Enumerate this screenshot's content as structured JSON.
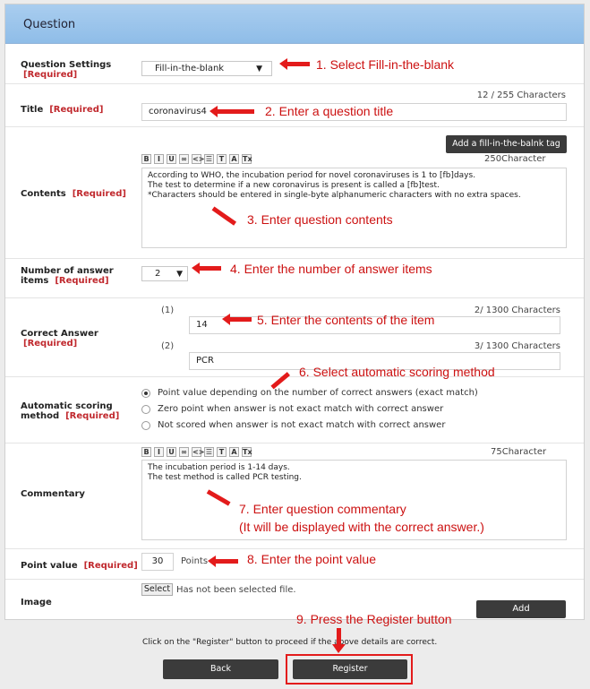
{
  "header": {
    "title": "Question"
  },
  "question_settings": {
    "label": "Question Settings",
    "required": "[Required]",
    "value": "Fill-in-the-blank",
    "annotation": "1. Select Fill-in-the-blank"
  },
  "title": {
    "label": "Title",
    "required": "[Required]",
    "value": "coronavirus4",
    "counter": "12 / 255 Characters",
    "annotation": "2. Enter a question title"
  },
  "contents": {
    "label": "Contents",
    "required": "[Required]",
    "add_tag_button": "Add a fill-in-the-balnk tag",
    "counter": "250Character",
    "toolbar": [
      "B",
      "I",
      "U",
      "∞",
      "<>",
      "☰",
      "T",
      "A",
      "Tx"
    ],
    "lines": [
      "According to WHO, the incubation period for novel coronaviruses is 1 to [fb]days.",
      "The test to determine if a new coronavirus is present is called a [fb]test.",
      "*Characters should be entered in single-byte alphanumeric characters with no extra spaces."
    ],
    "annotation": "3. Enter question contents"
  },
  "answer_items": {
    "label_line1": "Number of answer",
    "label_line2": "items",
    "required": "[Required]",
    "value": "2",
    "annotation": "4. Enter the number of answer items"
  },
  "correct_answer": {
    "label": "Correct Answer",
    "required": "[Required]",
    "items": [
      {
        "index": "(1)",
        "value": "14",
        "counter": "2/ 1300 Characters"
      },
      {
        "index": "(2)",
        "value": "PCR",
        "counter": "3/ 1300 Characters"
      }
    ],
    "annotation": "5. Enter the contents of the item"
  },
  "scoring": {
    "label_line1": "Automatic scoring",
    "label_line2": "method",
    "required": "[Required]",
    "options": [
      "Point value depending on the number of correct answers (exact match)",
      "Zero point when answer is not exact match with correct answer",
      "Not scored when answer is not exact match with correct answer"
    ],
    "selected_index": 0,
    "annotation": "6. Select automatic scoring method"
  },
  "commentary": {
    "label": "Commentary",
    "counter": "75Character",
    "lines": [
      "The incubation period is 1-14 days.",
      "The test method is called PCR testing."
    ],
    "annotation_line1": "7. Enter question commentary",
    "annotation_line2": "(It will be displayed with the correct answer.)"
  },
  "point_value": {
    "label": "Point value",
    "required": "[Required]",
    "value": "30",
    "unit": "Points",
    "annotation": "8. Enter the point value"
  },
  "image": {
    "label": "Image",
    "select_button": "Select",
    "status": "Has not been selected file.",
    "add_button": "Add"
  },
  "footer": {
    "annotation": "9. Press the Register button",
    "note": "Click on the \"Register\" button to proceed if the above details are correct.",
    "back_button": "Back",
    "register_button": "Register"
  },
  "colors": {
    "header": "#9ec7ee",
    "required": "#c0282d",
    "annotation": "#e31b1b",
    "button": "#3b3b3b"
  }
}
